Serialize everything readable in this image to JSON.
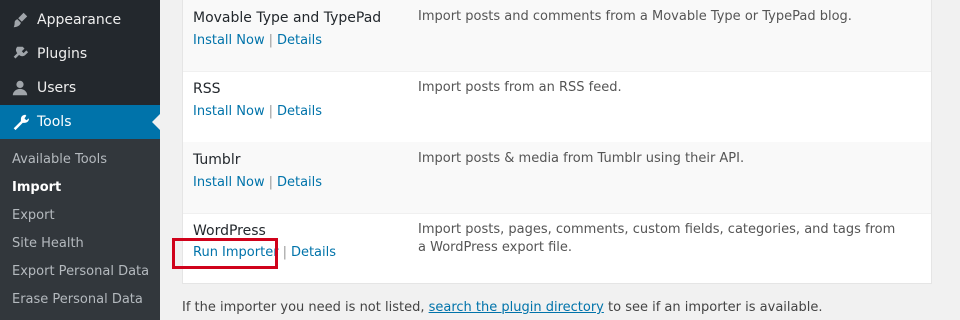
{
  "sidebar": {
    "menu": [
      {
        "label": "Appearance",
        "icon": "paintbrush-icon"
      },
      {
        "label": "Plugins",
        "icon": "plugin-icon"
      },
      {
        "label": "Users",
        "icon": "user-icon"
      },
      {
        "label": "Tools",
        "icon": "wrench-icon",
        "current": true
      }
    ],
    "submenu": [
      {
        "label": "Available Tools"
      },
      {
        "label": "Import",
        "active": true
      },
      {
        "label": "Export"
      },
      {
        "label": "Site Health"
      },
      {
        "label": "Export Personal Data"
      },
      {
        "label": "Erase Personal Data"
      }
    ]
  },
  "importers": [
    {
      "title": "Movable Type and TypePad",
      "action_label": "Install Now",
      "details_label": "Details",
      "separator": "|",
      "description": "Import posts and comments from a Movable Type or TypePad blog."
    },
    {
      "title": "RSS",
      "action_label": "Install Now",
      "details_label": "Details",
      "separator": "|",
      "description": "Import posts from an RSS feed."
    },
    {
      "title": "Tumblr",
      "action_label": "Install Now",
      "details_label": "Details",
      "separator": "|",
      "description": "Import posts & media from Tumblr using their API."
    },
    {
      "title": "WordPress",
      "action_label": "Run Importer",
      "details_label": "Details",
      "separator": "|",
      "description": "Import posts, pages, comments, custom fields, categories, and tags from a WordPress export file."
    }
  ],
  "footer": {
    "text_before": "If the importer you need is not listed, ",
    "link_text": "search the plugin directory",
    "text_after": " to see if an importer is available."
  },
  "colors": {
    "sidebar_bg": "#23282d",
    "submenu_bg": "#32373c",
    "accent": "#0073aa",
    "highlight": "#d0021b"
  }
}
